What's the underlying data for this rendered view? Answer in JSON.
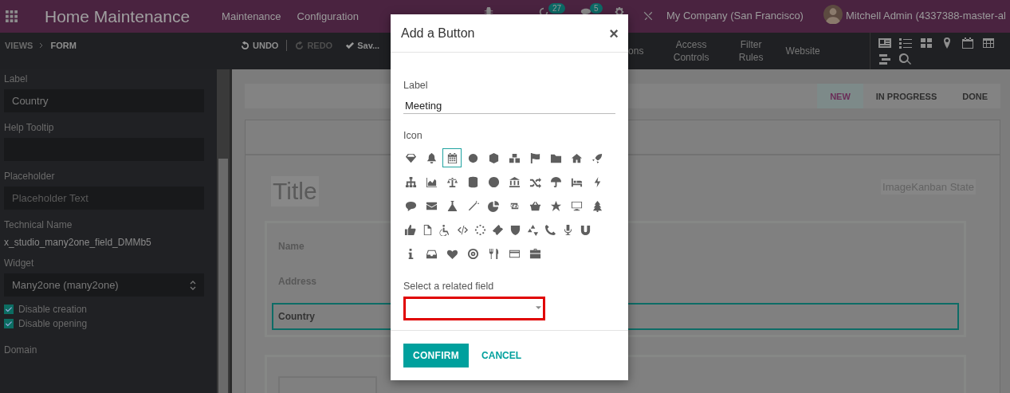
{
  "navbar": {
    "app_title": "Home Maintenance",
    "menus": [
      "Maintenance",
      "Configuration"
    ],
    "activity_badge": "27",
    "message_badge": "5",
    "company": "My Company (San Francisco)",
    "user": "Mitchell Admin (4337388-master-al"
  },
  "toolbar": {
    "breadcrumbs": [
      "VIEWS",
      "FORM"
    ],
    "undo": "UNDO",
    "redo": {
      "label": "REDO",
      "disabled": true
    },
    "save": "Sav...",
    "menus": [
      "ons",
      "Access Controls",
      "Filter Rules",
      "Website"
    ]
  },
  "sidebar": {
    "fields": [
      {
        "kind": "text",
        "label": "Label",
        "value": "Country"
      },
      {
        "kind": "text",
        "label": "Help Tooltip"
      },
      {
        "kind": "text",
        "label": "Placeholder",
        "placeholder": "Placeholder Text"
      },
      {
        "kind": "static",
        "label": "Technical Name",
        "value": "x_studio_many2one_field_DMMb5"
      },
      {
        "kind": "select",
        "label": "Widget",
        "value": "Many2one (many2one)"
      },
      {
        "kind": "checkbox",
        "label": "Disable creation",
        "checked": true
      },
      {
        "kind": "checkbox",
        "label": "Disable opening",
        "checked": true
      },
      {
        "kind": "heading",
        "label": "Domain"
      }
    ]
  },
  "form": {
    "stages": [
      {
        "label": "NEW",
        "selected": true
      },
      {
        "label": "IN PROGRESS",
        "selected": false
      },
      {
        "label": "DONE",
        "selected": false
      }
    ],
    "title_placeholder": "Title",
    "image_label": "ImageKanban State",
    "fields": [
      {
        "label": "Name",
        "selected": false
      },
      {
        "label": "Address",
        "selected": false
      },
      {
        "label": "Country",
        "selected": true
      }
    ]
  },
  "dialog": {
    "title": "Add a Button",
    "close": "×",
    "label_caption": "Label",
    "label_value": "Meeting",
    "icon_caption": "Icon",
    "icon_rows": [
      [
        {
          "selected": false
        },
        {
          "selected": false
        },
        {
          "selected": true
        },
        {
          "selected": false
        },
        {
          "selected": false
        },
        {
          "selected": false
        },
        {
          "selected": false
        },
        {
          "selected": false
        },
        {
          "selected": false
        },
        {
          "selected": false
        }
      ],
      [
        {
          "selected": false
        },
        {
          "selected": false
        },
        {
          "selected": false
        },
        {
          "selected": false
        },
        {
          "selected": false
        },
        {
          "selected": false
        },
        {
          "selected": false
        },
        {
          "selected": false
        },
        {
          "selected": false
        },
        {
          "selected": false
        }
      ],
      [
        {
          "selected": false
        },
        {
          "selected": false
        },
        {
          "selected": false
        },
        {
          "selected": false
        },
        {
          "selected": false
        },
        {
          "selected": false
        },
        {
          "selected": false
        },
        {
          "selected": false
        },
        {
          "selected": false
        },
        {
          "selected": false
        }
      ],
      [
        {
          "selected": false
        },
        {
          "selected": false
        },
        {
          "selected": false
        },
        {
          "selected": false
        },
        {
          "selected": false
        },
        {
          "selected": false
        },
        {
          "selected": false
        },
        {
          "selected": false
        },
        {
          "selected": false
        },
        {
          "selected": false
        },
        {
          "selected": false
        }
      ],
      [
        {
          "selected": false
        },
        {
          "selected": false
        },
        {
          "selected": false
        },
        {
          "selected": false
        },
        {
          "selected": false
        },
        {
          "selected": false
        },
        {
          "selected": false
        }
      ]
    ],
    "related_caption": "Select a related field",
    "related_highlighted": true,
    "confirm": "CONFIRM",
    "cancel": "CANCEL"
  }
}
